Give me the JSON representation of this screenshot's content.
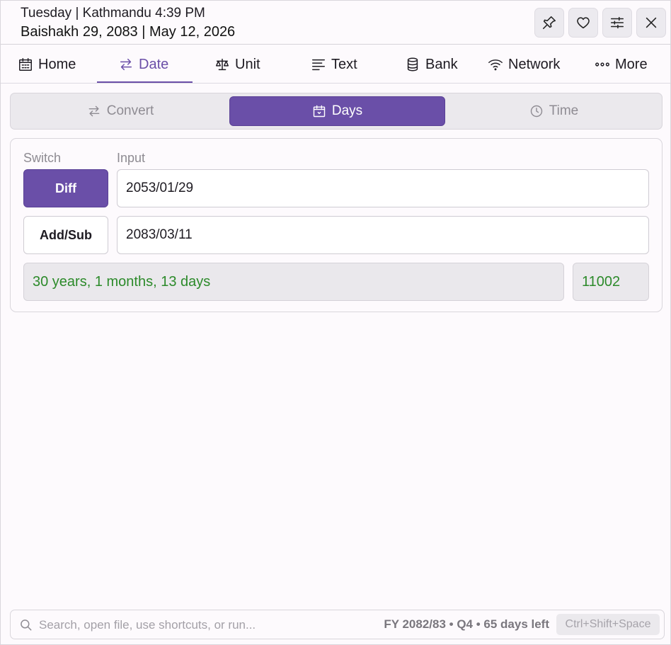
{
  "header": {
    "line1": "Tuesday | Kathmandu 4:39 PM",
    "line2": "Baishakh 29, 2083 | May 12, 2026",
    "buttons": [
      {
        "name": "pin-button",
        "icon": "pin-icon"
      },
      {
        "name": "favorite-button",
        "icon": "heart-icon"
      },
      {
        "name": "settings-button",
        "icon": "sliders-icon"
      },
      {
        "name": "close-button",
        "icon": "close-icon"
      }
    ]
  },
  "nav": {
    "items": [
      {
        "label": "Home",
        "icon": "calendar-icon"
      },
      {
        "label": "Date",
        "icon": "swap-icon",
        "active": true
      },
      {
        "label": "Unit",
        "icon": "scale-icon"
      },
      {
        "label": "Text",
        "icon": "text-lines-icon"
      },
      {
        "label": "Bank",
        "icon": "database-icon"
      },
      {
        "label": "Network",
        "icon": "wifi-icon"
      },
      {
        "label": "More",
        "icon": "more-dots-icon"
      }
    ]
  },
  "subtabs": {
    "items": [
      {
        "label": "Convert",
        "icon": "swap-icon"
      },
      {
        "label": "Days",
        "icon": "calendar-icon",
        "active": true
      },
      {
        "label": "Time",
        "icon": "clock-icon"
      }
    ]
  },
  "days": {
    "switch_label": "Switch",
    "input_label": "Input",
    "diff_label": "Diff",
    "addsub_label": "Add/Sub",
    "date1": "2053/01/29",
    "date2": "2083/03/11",
    "result_text": "30 years, 1 months, 13 days",
    "result_days": "11002"
  },
  "bottombar": {
    "search_placeholder": "Search, open file, use shortcuts, or run...",
    "fy_info": "FY 2082/83 • Q4 • 65 days left",
    "shortcut": "Ctrl+Shift+Space"
  },
  "colors": {
    "accent": "#6a4fa8",
    "result_green": "#2c8a2a",
    "background": "#fdfafd"
  }
}
